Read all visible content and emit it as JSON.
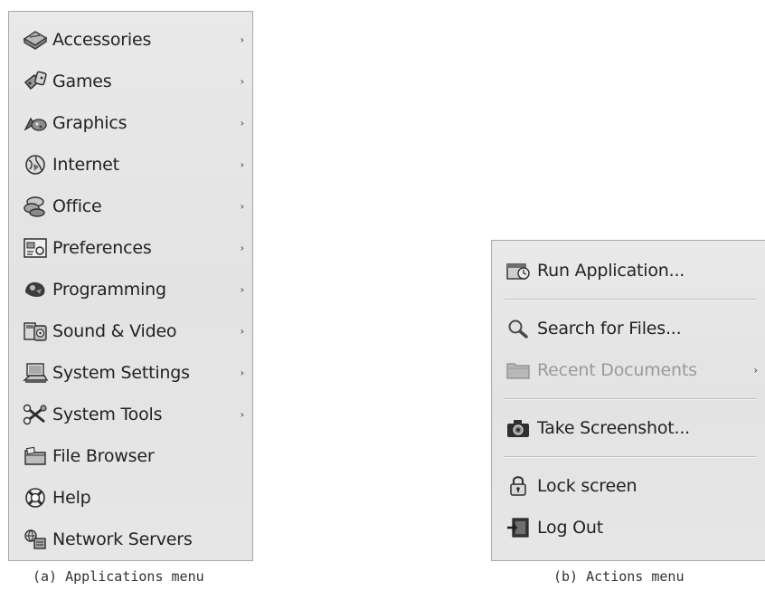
{
  "applications_menu": {
    "items": [
      {
        "label": "Accessories",
        "icon": "accessories-icon",
        "has_submenu": true
      },
      {
        "label": "Games",
        "icon": "games-icon",
        "has_submenu": true
      },
      {
        "label": "Graphics",
        "icon": "graphics-icon",
        "has_submenu": true
      },
      {
        "label": "Internet",
        "icon": "internet-icon",
        "has_submenu": true
      },
      {
        "label": "Office",
        "icon": "office-icon",
        "has_submenu": true
      },
      {
        "label": "Preferences",
        "icon": "preferences-icon",
        "has_submenu": true
      },
      {
        "label": "Programming",
        "icon": "programming-icon",
        "has_submenu": true
      },
      {
        "label": "Sound & Video",
        "icon": "sound-video-icon",
        "has_submenu": true
      },
      {
        "label": "System Settings",
        "icon": "system-settings-icon",
        "has_submenu": true
      },
      {
        "label": "System Tools",
        "icon": "system-tools-icon",
        "has_submenu": true
      },
      {
        "label": "File Browser",
        "icon": "file-browser-icon",
        "has_submenu": false
      },
      {
        "label": "Help",
        "icon": "help-icon",
        "has_submenu": false
      },
      {
        "label": "Network Servers",
        "icon": "network-servers-icon",
        "has_submenu": false
      }
    ],
    "submenu_arrow": "›"
  },
  "actions_menu": {
    "items": [
      {
        "label": "Run Application...",
        "icon": "run-application-icon"
      },
      {
        "label": "Search for Files...",
        "icon": "search-icon"
      },
      {
        "label": "Recent Documents",
        "icon": "folder-icon",
        "disabled": true,
        "has_submenu": true
      },
      {
        "label": "Take Screenshot...",
        "icon": "camera-icon"
      },
      {
        "label": "Lock screen",
        "icon": "lock-icon"
      },
      {
        "label": "Log Out",
        "icon": "log-out-icon"
      }
    ],
    "submenu_arrow": "›"
  },
  "captions": {
    "a": "(a) Applications menu",
    "b": "(b) Actions menu"
  },
  "colors": {
    "menu_background": "#e6e6e6",
    "menu_border": "#a8a8a8",
    "text": "#222222",
    "disabled_text": "#9a9a9a"
  }
}
